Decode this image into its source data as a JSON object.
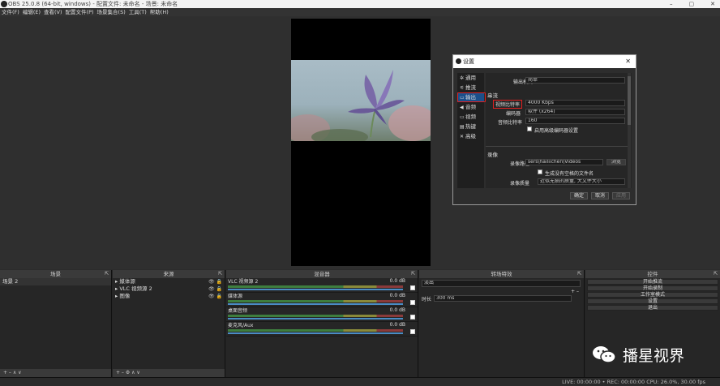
{
  "window": {
    "title": "OBS 25.0.8 (64-bit, windows) - 配置文件: 未命名 - 场景: 未命名",
    "minimize": "–",
    "maximize": "▢",
    "close": "✕"
  },
  "menu": [
    "文件(F)",
    "编辑(E)",
    "查看(V)",
    "配置文件(P)",
    "场景集合(S)",
    "工具(T)",
    "帮助(H)"
  ],
  "dialog": {
    "title": "设置",
    "close": "✕",
    "nav": [
      {
        "label": "通用",
        "icon": "✲"
      },
      {
        "label": "推流",
        "icon": "⚟"
      },
      {
        "label": "输出",
        "icon": "▭"
      },
      {
        "label": "音频",
        "icon": "◀"
      },
      {
        "label": "视频",
        "icon": "▭"
      },
      {
        "label": "热键",
        "icon": "▤"
      },
      {
        "label": "高级",
        "icon": "✕"
      }
    ],
    "output_mode_label": "输出模式",
    "output_mode_value": "简单",
    "stream_section": "串流",
    "video_bitrate_label": "视频比特率",
    "video_bitrate_value": "4000 Kbps",
    "encoder_label": "编码器",
    "encoder_value": "软件 (x264)",
    "audio_bitrate_label": "音频比特率",
    "audio_bitrate_value": "160",
    "advanced_encoder_label": "启用高级编码器设置",
    "record_section": "录像",
    "record_path_label": "录像路径",
    "record_path_value": "sers\\hailiichen\\Videos",
    "browse_label": "浏览",
    "no_space_label": "生成没有空格的文件名",
    "record_quality_label": "录像质量",
    "record_quality_value": "近似无损的质量, 大文件大小",
    "ok": "确定",
    "cancel": "取消",
    "apply": "应用"
  },
  "panels": {
    "scenes": {
      "title": "场景",
      "items": [
        "场景 2"
      ],
      "footer": "+ – ∧ ∨"
    },
    "sources": {
      "title": "来源",
      "items": [
        "媒体源",
        "VLC 视频源 2",
        "图像"
      ],
      "footer": "+ – ⚙ ∧ ∨"
    },
    "mixer": {
      "title": "混音器",
      "channels": [
        {
          "name": "VLC 视频源 2",
          "db": "0.0 dB"
        },
        {
          "name": "媒体源",
          "db": "0.0 dB"
        },
        {
          "name": "桌面音频",
          "db": "0.0 dB"
        },
        {
          "name": "麦克风/Aux",
          "db": "0.0 dB"
        }
      ]
    },
    "transitions": {
      "title": "转场特效",
      "mode": "淡出",
      "duration_label": "时长",
      "duration_value": "300 ms",
      "plus_minus": "+ –"
    },
    "controls": {
      "title": "控件",
      "buttons": [
        "开始推流",
        "开始录制",
        "工作室模式",
        "设置",
        "退出"
      ]
    }
  },
  "status": {
    "text": "LIVE: 00:00:00 • REC: 00:00:00  CPU: 26.0%, 30.00 fps"
  },
  "watermark": {
    "text": "播星视界"
  }
}
